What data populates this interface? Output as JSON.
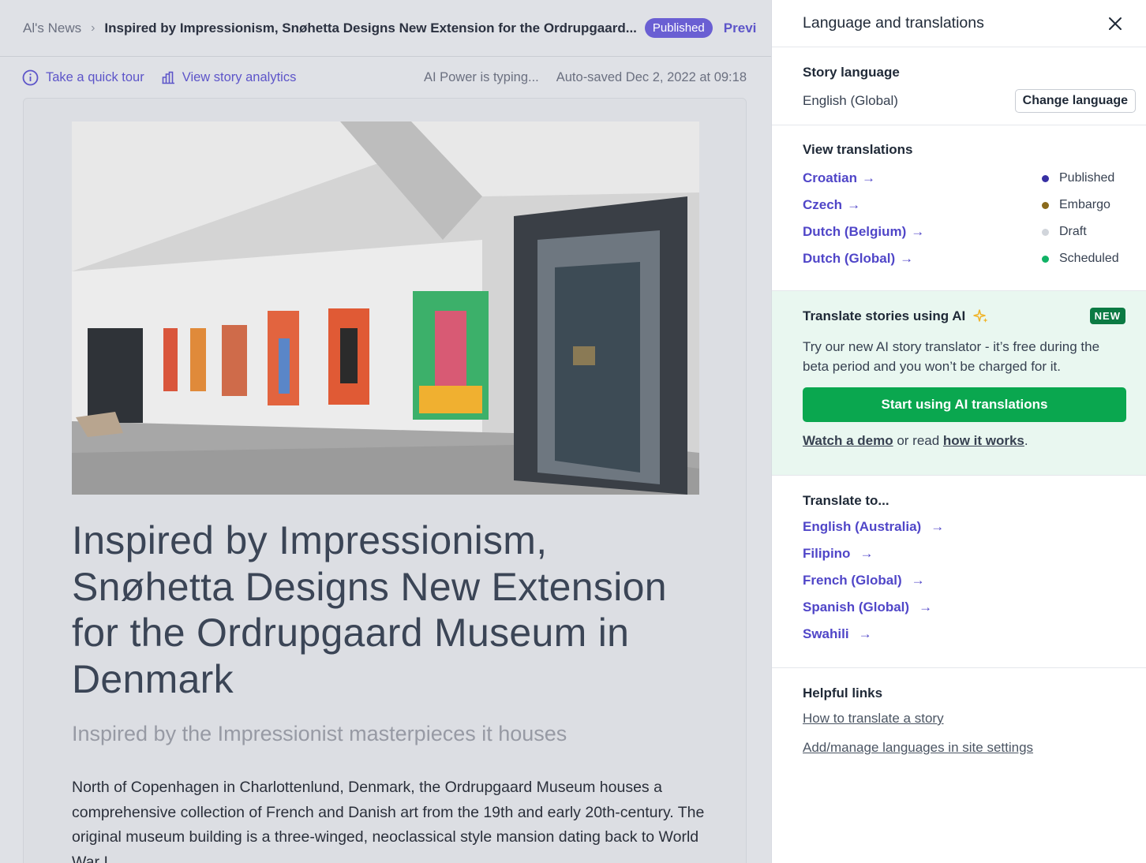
{
  "editor": {
    "breadcrumb_root": "Al's News",
    "breadcrumb_title": "Inspired by Impressionism, Snøhetta Designs New Extension for the Ordrupgaard...",
    "status_badge": "Published",
    "preview_label": "Previ",
    "tour_label": "Take a quick tour",
    "analytics_label": "View story analytics",
    "typing_status": "AI Power is typing...",
    "autosave_status": "Auto-saved Dec 2, 2022 at 09:18"
  },
  "article": {
    "title": "Inspired by Impressionism, Snøhetta Designs New Extension for the Ordrupgaard Museum in Denmark",
    "subtitle": "Inspired by the Impressionist masterpieces it houses",
    "body": "North of Copenhagen in Charlottenlund, Denmark, the Ordrupgaard Museum houses a comprehensive collection of French and Danish art from the 19th and early 20th-century. The original museum building is a three-winged, neoclassical style mansion dating back to World War I."
  },
  "panel": {
    "title": "Language and translations",
    "story_language": {
      "heading": "Story language",
      "value": "English (Global)",
      "change_button": "Change language"
    },
    "view_translations": {
      "heading": "View translations",
      "items": [
        {
          "label": "Croatian",
          "arrow": "→"
        },
        {
          "label": "Czech",
          "arrow": "→"
        },
        {
          "label": "Dutch (Belgium)",
          "arrow": "→"
        },
        {
          "label": "Dutch (Global)",
          "arrow": "→"
        }
      ],
      "legend": [
        {
          "label": "Published",
          "color": "#3730a3"
        },
        {
          "label": "Embargo",
          "color": "#8a6a1c"
        },
        {
          "label": "Draft",
          "color": "#d1d5db"
        },
        {
          "label": "Scheduled",
          "color": "#10b265"
        }
      ]
    },
    "ai": {
      "heading": "Translate stories using AI",
      "badge": "NEW",
      "text": "Try our new AI story translator - it’s free during the beta period and you won’t be charged for it.",
      "button": "Start using AI translations",
      "demo_link": "Watch a demo",
      "middle_text": " or read ",
      "how_link": "how it works",
      "end_text": "."
    },
    "translate_to": {
      "heading": "Translate to...",
      "items": [
        {
          "label": "English (Australia)",
          "arrow": "→"
        },
        {
          "label": "Filipino",
          "arrow": "→"
        },
        {
          "label": "French (Global)",
          "arrow": "→"
        },
        {
          "label": "Spanish (Global)",
          "arrow": "→"
        },
        {
          "label": "Swahili",
          "arrow": "→"
        }
      ]
    },
    "helpful_links": {
      "heading": "Helpful links",
      "links": [
        "How to translate a story",
        "Add/manage languages in site settings"
      ]
    }
  },
  "colors": {
    "accent": "#5046c8",
    "green": "#0aa74f",
    "badge_green": "#0b7a43",
    "ai_bg": "#e9f7f0"
  }
}
